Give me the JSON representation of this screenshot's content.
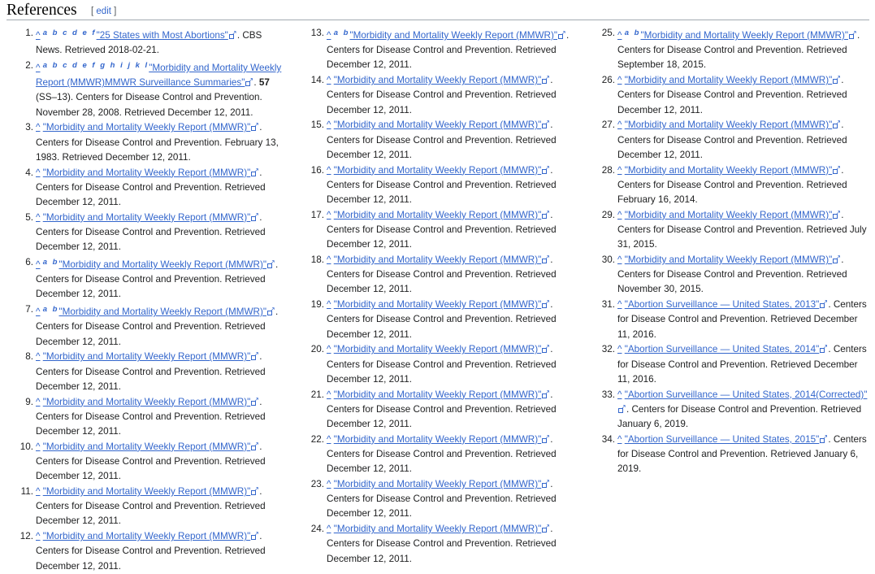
{
  "section": {
    "title": "References",
    "edit_open": "[",
    "edit_label": "edit",
    "edit_close": "]"
  },
  "references": [
    {
      "n": "1.",
      "caret": "^",
      "backlinks": "a b c d e f",
      "title": "\"25 States with Most Abortions\"",
      "rest": ". CBS News. Retrieved 2018-02-21."
    },
    {
      "n": "2.",
      "caret": "^",
      "backlinks": "a b c d e f g h i j k l",
      "title": "\"Morbidity and Mortality Weekly Report (MMWR)MMWR Surveillance Summaries\"",
      "rest": ". ",
      "vol": "57",
      "rest2": " (SS–13). Centers for Disease Control and Prevention. November 28, 2008. Retrieved December 12, 2011."
    },
    {
      "n": "3.",
      "caret": "^",
      "backlinks": "",
      "title": "\"Morbidity and Mortality Weekly Report (MMWR)\"",
      "rest": ". Centers for Disease Control and Prevention. February 13, 1983. Retrieved December 12, 2011."
    },
    {
      "n": "4.",
      "caret": "^",
      "backlinks": "",
      "title": "\"Morbidity and Mortality Weekly Report (MMWR)\"",
      "rest": ". Centers for Disease Control and Prevention. Retrieved December 12, 2011."
    },
    {
      "n": "5.",
      "caret": "^",
      "backlinks": "",
      "title": "\"Morbidity and Mortality Weekly Report (MMWR)\"",
      "rest": ". Centers for Disease Control and Prevention. Retrieved December 12, 2011."
    },
    {
      "n": "6.",
      "caret": "^",
      "backlinks": "a b",
      "title": "\"Morbidity and Mortality Weekly Report (MMWR)\"",
      "rest": ". Centers for Disease Control and Prevention. Retrieved December 12, 2011."
    },
    {
      "n": "7.",
      "caret": "^",
      "backlinks": "a b",
      "title": "\"Morbidity and Mortality Weekly Report (MMWR)\"",
      "rest": ". Centers for Disease Control and Prevention. Retrieved December 12, 2011."
    },
    {
      "n": "8.",
      "caret": "^",
      "backlinks": "",
      "title": "\"Morbidity and Mortality Weekly Report (MMWR)\"",
      "rest": ". Centers for Disease Control and Prevention. Retrieved December 12, 2011."
    },
    {
      "n": "9.",
      "caret": "^",
      "backlinks": "",
      "title": "\"Morbidity and Mortality Weekly Report (MMWR)\"",
      "rest": ". Centers for Disease Control and Prevention. Retrieved December 12, 2011."
    },
    {
      "n": "10.",
      "caret": "^",
      "backlinks": "",
      "title": "\"Morbidity and Mortality Weekly Report (MMWR)\"",
      "rest": ". Centers for Disease Control and Prevention. Retrieved December 12, 2011."
    },
    {
      "n": "11.",
      "caret": "^",
      "backlinks": "",
      "title": "\"Morbidity and Mortality Weekly Report (MMWR)\"",
      "rest": ". Centers for Disease Control and Prevention. Retrieved December 12, 2011."
    },
    {
      "n": "12.",
      "caret": "^",
      "backlinks": "",
      "title": "\"Morbidity and Mortality Weekly Report (MMWR)\"",
      "rest": ". Centers for Disease Control and Prevention. Retrieved December 12, 2011."
    },
    {
      "n": "13.",
      "caret": "^",
      "backlinks": "a b",
      "title": "\"Morbidity and Mortality Weekly Report (MMWR)\"",
      "rest": ". Centers for Disease Control and Prevention. Retrieved December 12, 2011."
    },
    {
      "n": "14.",
      "caret": "^",
      "backlinks": "",
      "title": "\"Morbidity and Mortality Weekly Report (MMWR)\"",
      "rest": ". Centers for Disease Control and Prevention. Retrieved December 12, 2011."
    },
    {
      "n": "15.",
      "caret": "^",
      "backlinks": "",
      "title": "\"Morbidity and Mortality Weekly Report (MMWR)\"",
      "rest": ". Centers for Disease Control and Prevention. Retrieved December 12, 2011."
    },
    {
      "n": "16.",
      "caret": "^",
      "backlinks": "",
      "title": "\"Morbidity and Mortality Weekly Report (MMWR)\"",
      "rest": ". Centers for Disease Control and Prevention. Retrieved December 12, 2011."
    },
    {
      "n": "17.",
      "caret": "^",
      "backlinks": "",
      "title": "\"Morbidity and Mortality Weekly Report (MMWR)\"",
      "rest": ". Centers for Disease Control and Prevention. Retrieved December 12, 2011."
    },
    {
      "n": "18.",
      "caret": "^",
      "backlinks": "",
      "title": "\"Morbidity and Mortality Weekly Report (MMWR)\"",
      "rest": ". Centers for Disease Control and Prevention. Retrieved December 12, 2011."
    },
    {
      "n": "19.",
      "caret": "^",
      "backlinks": "",
      "title": "\"Morbidity and Mortality Weekly Report (MMWR)\"",
      "rest": ". Centers for Disease Control and Prevention. Retrieved December 12, 2011."
    },
    {
      "n": "20.",
      "caret": "^",
      "backlinks": "",
      "title": "\"Morbidity and Mortality Weekly Report (MMWR)\"",
      "rest": ". Centers for Disease Control and Prevention. Retrieved December 12, 2011."
    },
    {
      "n": "21.",
      "caret": "^",
      "backlinks": "",
      "title": "\"Morbidity and Mortality Weekly Report (MMWR)\"",
      "rest": ". Centers for Disease Control and Prevention. Retrieved December 12, 2011."
    },
    {
      "n": "22.",
      "caret": "^",
      "backlinks": "",
      "title": "\"Morbidity and Mortality Weekly Report (MMWR)\"",
      "rest": ". Centers for Disease Control and Prevention. Retrieved December 12, 2011."
    },
    {
      "n": "23.",
      "caret": "^",
      "backlinks": "",
      "title": "\"Morbidity and Mortality Weekly Report (MMWR)\"",
      "rest": ". Centers for Disease Control and Prevention. Retrieved December 12, 2011."
    },
    {
      "n": "24.",
      "caret": "^",
      "backlinks": "",
      "title": "\"Morbidity and Mortality Weekly Report (MMWR)\"",
      "rest": ". Centers for Disease Control and Prevention. Retrieved December 12, 2011."
    },
    {
      "n": "25.",
      "caret": "^",
      "backlinks": "a b",
      "title": "\"Morbidity and Mortality Weekly Report (MMWR)\"",
      "rest": ". Centers for Disease Control and Prevention. Retrieved September 18, 2015."
    },
    {
      "n": "26.",
      "caret": "^",
      "backlinks": "",
      "title": "\"Morbidity and Mortality Weekly Report (MMWR)\"",
      "rest": ". Centers for Disease Control and Prevention. Retrieved December 12, 2011."
    },
    {
      "n": "27.",
      "caret": "^",
      "backlinks": "",
      "title": "\"Morbidity and Mortality Weekly Report (MMWR)\"",
      "rest": ". Centers for Disease Control and Prevention. Retrieved December 12, 2011."
    },
    {
      "n": "28.",
      "caret": "^",
      "backlinks": "",
      "title": "\"Morbidity and Mortality Weekly Report (MMWR)\"",
      "rest": ". Centers for Disease Control and Prevention. Retrieved February 16, 2014."
    },
    {
      "n": "29.",
      "caret": "^",
      "backlinks": "",
      "title": "\"Morbidity and Mortality Weekly Report (MMWR)\"",
      "rest": ". Centers for Disease Control and Prevention. Retrieved July 31, 2015."
    },
    {
      "n": "30.",
      "caret": "^",
      "backlinks": "",
      "title": "\"Morbidity and Mortality Weekly Report (MMWR)\"",
      "rest": ". Centers for Disease Control and Prevention. Retrieved November 30, 2015."
    },
    {
      "n": "31.",
      "caret": "^",
      "backlinks": "",
      "title": "\"Abortion Surveillance — United States, 2013\"",
      "rest": ". Centers for Disease Control and Prevention. Retrieved December 11, 2016."
    },
    {
      "n": "32.",
      "caret": "^",
      "backlinks": "",
      "title": "\"Abortion Surveillance — United States, 2014\"",
      "rest": ". Centers for Disease Control and Prevention. Retrieved December 11, 2016."
    },
    {
      "n": "33.",
      "caret": "^",
      "backlinks": "",
      "title": "\"Abortion Surveillance — United States, 2014(Corrected)\"",
      "rest": ". Centers for Disease Control and Prevention. Retrieved January 6, 2019."
    },
    {
      "n": "34.",
      "caret": "^",
      "backlinks": "",
      "title": "\"Abortion Surveillance — United States, 2015\"",
      "rest": ". Centers for Disease Control and Prevention. Retrieved January 6, 2019."
    }
  ]
}
